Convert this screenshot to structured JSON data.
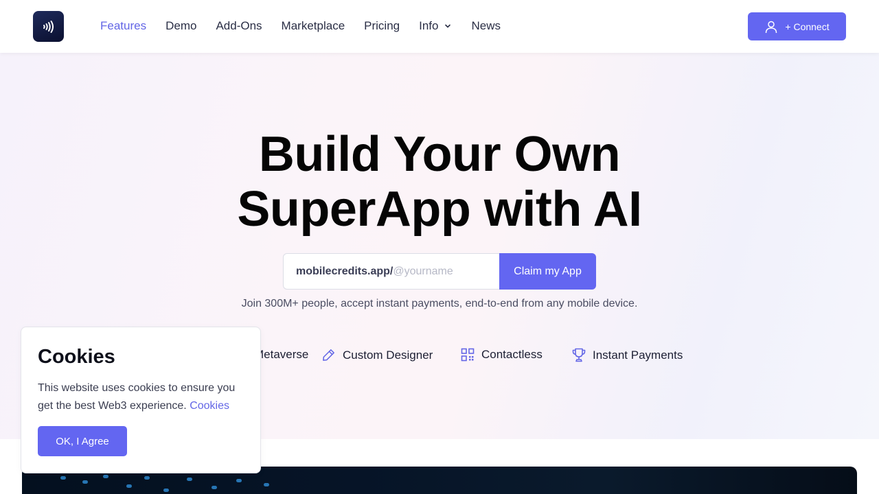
{
  "nav": {
    "logo_icon": "nfc-signal-icon",
    "links": [
      {
        "label": "Features",
        "active": true
      },
      {
        "label": "Demo"
      },
      {
        "label": "Add-Ons"
      },
      {
        "label": "Marketplace"
      },
      {
        "label": "Pricing"
      },
      {
        "label": "Info",
        "dropdown": true
      },
      {
        "label": "News"
      }
    ],
    "connect_label": "+ Connect"
  },
  "hero": {
    "title_line1": "Build Your Own",
    "title_line2": "SuperApp with AI",
    "input_prefix": "mobilecredits.app/",
    "input_placeholder": "@yourname",
    "claim_label": "Claim my App",
    "subtitle": "Join 300M+ people, accept instant payments, end-to-end from any mobile device."
  },
  "features": [
    {
      "label": "Metaverse",
      "icon": "metaverse-icon"
    },
    {
      "label": "Custom Designer",
      "icon": "pencil-icon"
    },
    {
      "label": "Contactless",
      "icon": "qr-code-icon"
    },
    {
      "label": "Instant Payments",
      "icon": "trophy-icon"
    }
  ],
  "cookie": {
    "title": "Cookies",
    "text": "This website uses cookies to ensure you get the best Web3 experience.",
    "link": "Cookies",
    "button": "OK, I Agree"
  },
  "colors": {
    "accent": "#6366f1",
    "active_link": "#6366e6",
    "title": "#050505"
  }
}
